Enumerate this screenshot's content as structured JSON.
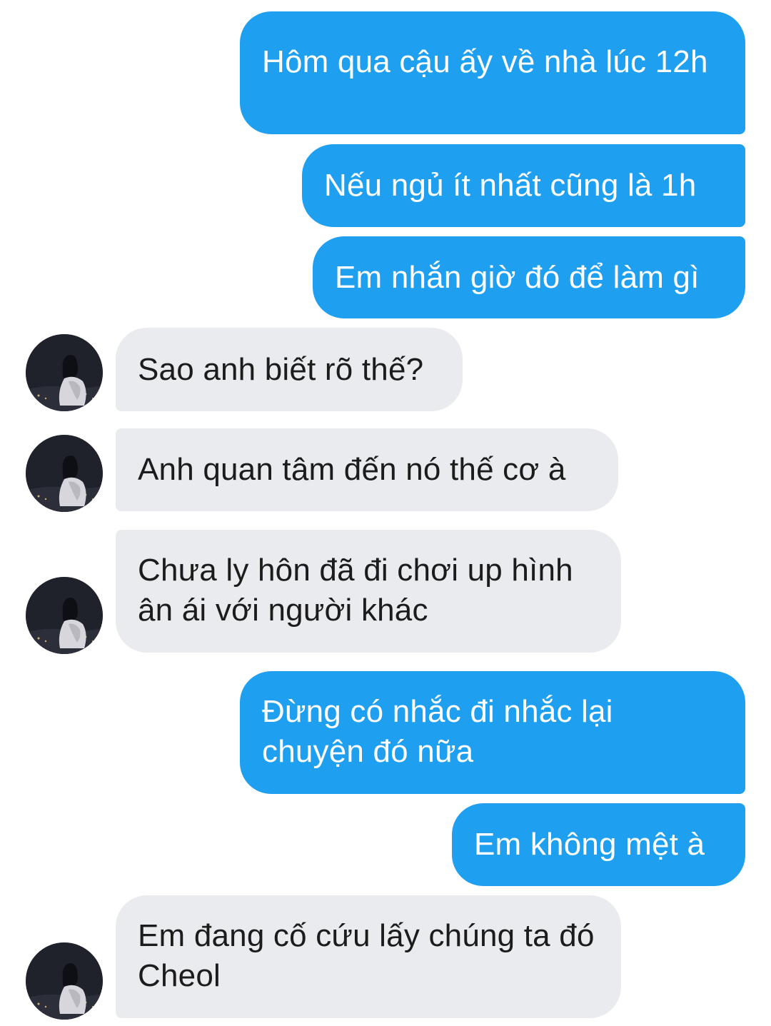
{
  "conversation": {
    "messages": [
      {
        "id": "m1",
        "direction": "outgoing",
        "text": "Hôm qua cậu ấy về nhà lúc 12h"
      },
      {
        "id": "m2",
        "direction": "outgoing",
        "text": "Nếu ngủ ít nhất cũng là 1h"
      },
      {
        "id": "m3",
        "direction": "outgoing",
        "text": "Em nhắn giờ đó để làm gì"
      },
      {
        "id": "m4",
        "direction": "incoming",
        "text": "Sao anh biết rõ thế?"
      },
      {
        "id": "m5",
        "direction": "incoming",
        "text": "Anh quan tâm đến nó thế cơ à"
      },
      {
        "id": "m6",
        "direction": "incoming",
        "text": "Chưa ly hôn đã đi chơi up hình ân ái với người khác"
      },
      {
        "id": "m7",
        "direction": "outgoing",
        "text": "Đừng có nhắc đi nhắc lại chuyện đó nữa"
      },
      {
        "id": "m8",
        "direction": "outgoing",
        "text": "Em không mệt à"
      },
      {
        "id": "m9",
        "direction": "incoming",
        "text": "Em đang cố cứu lấy chúng ta đó Cheol"
      }
    ]
  },
  "colors": {
    "outgoing_bubble": "#1f9ff0",
    "incoming_bubble": "#e9ebef",
    "outgoing_text": "#ffffff",
    "incoming_text": "#1c1c1c"
  },
  "icons": {
    "avatar": "contact-avatar-photo"
  }
}
